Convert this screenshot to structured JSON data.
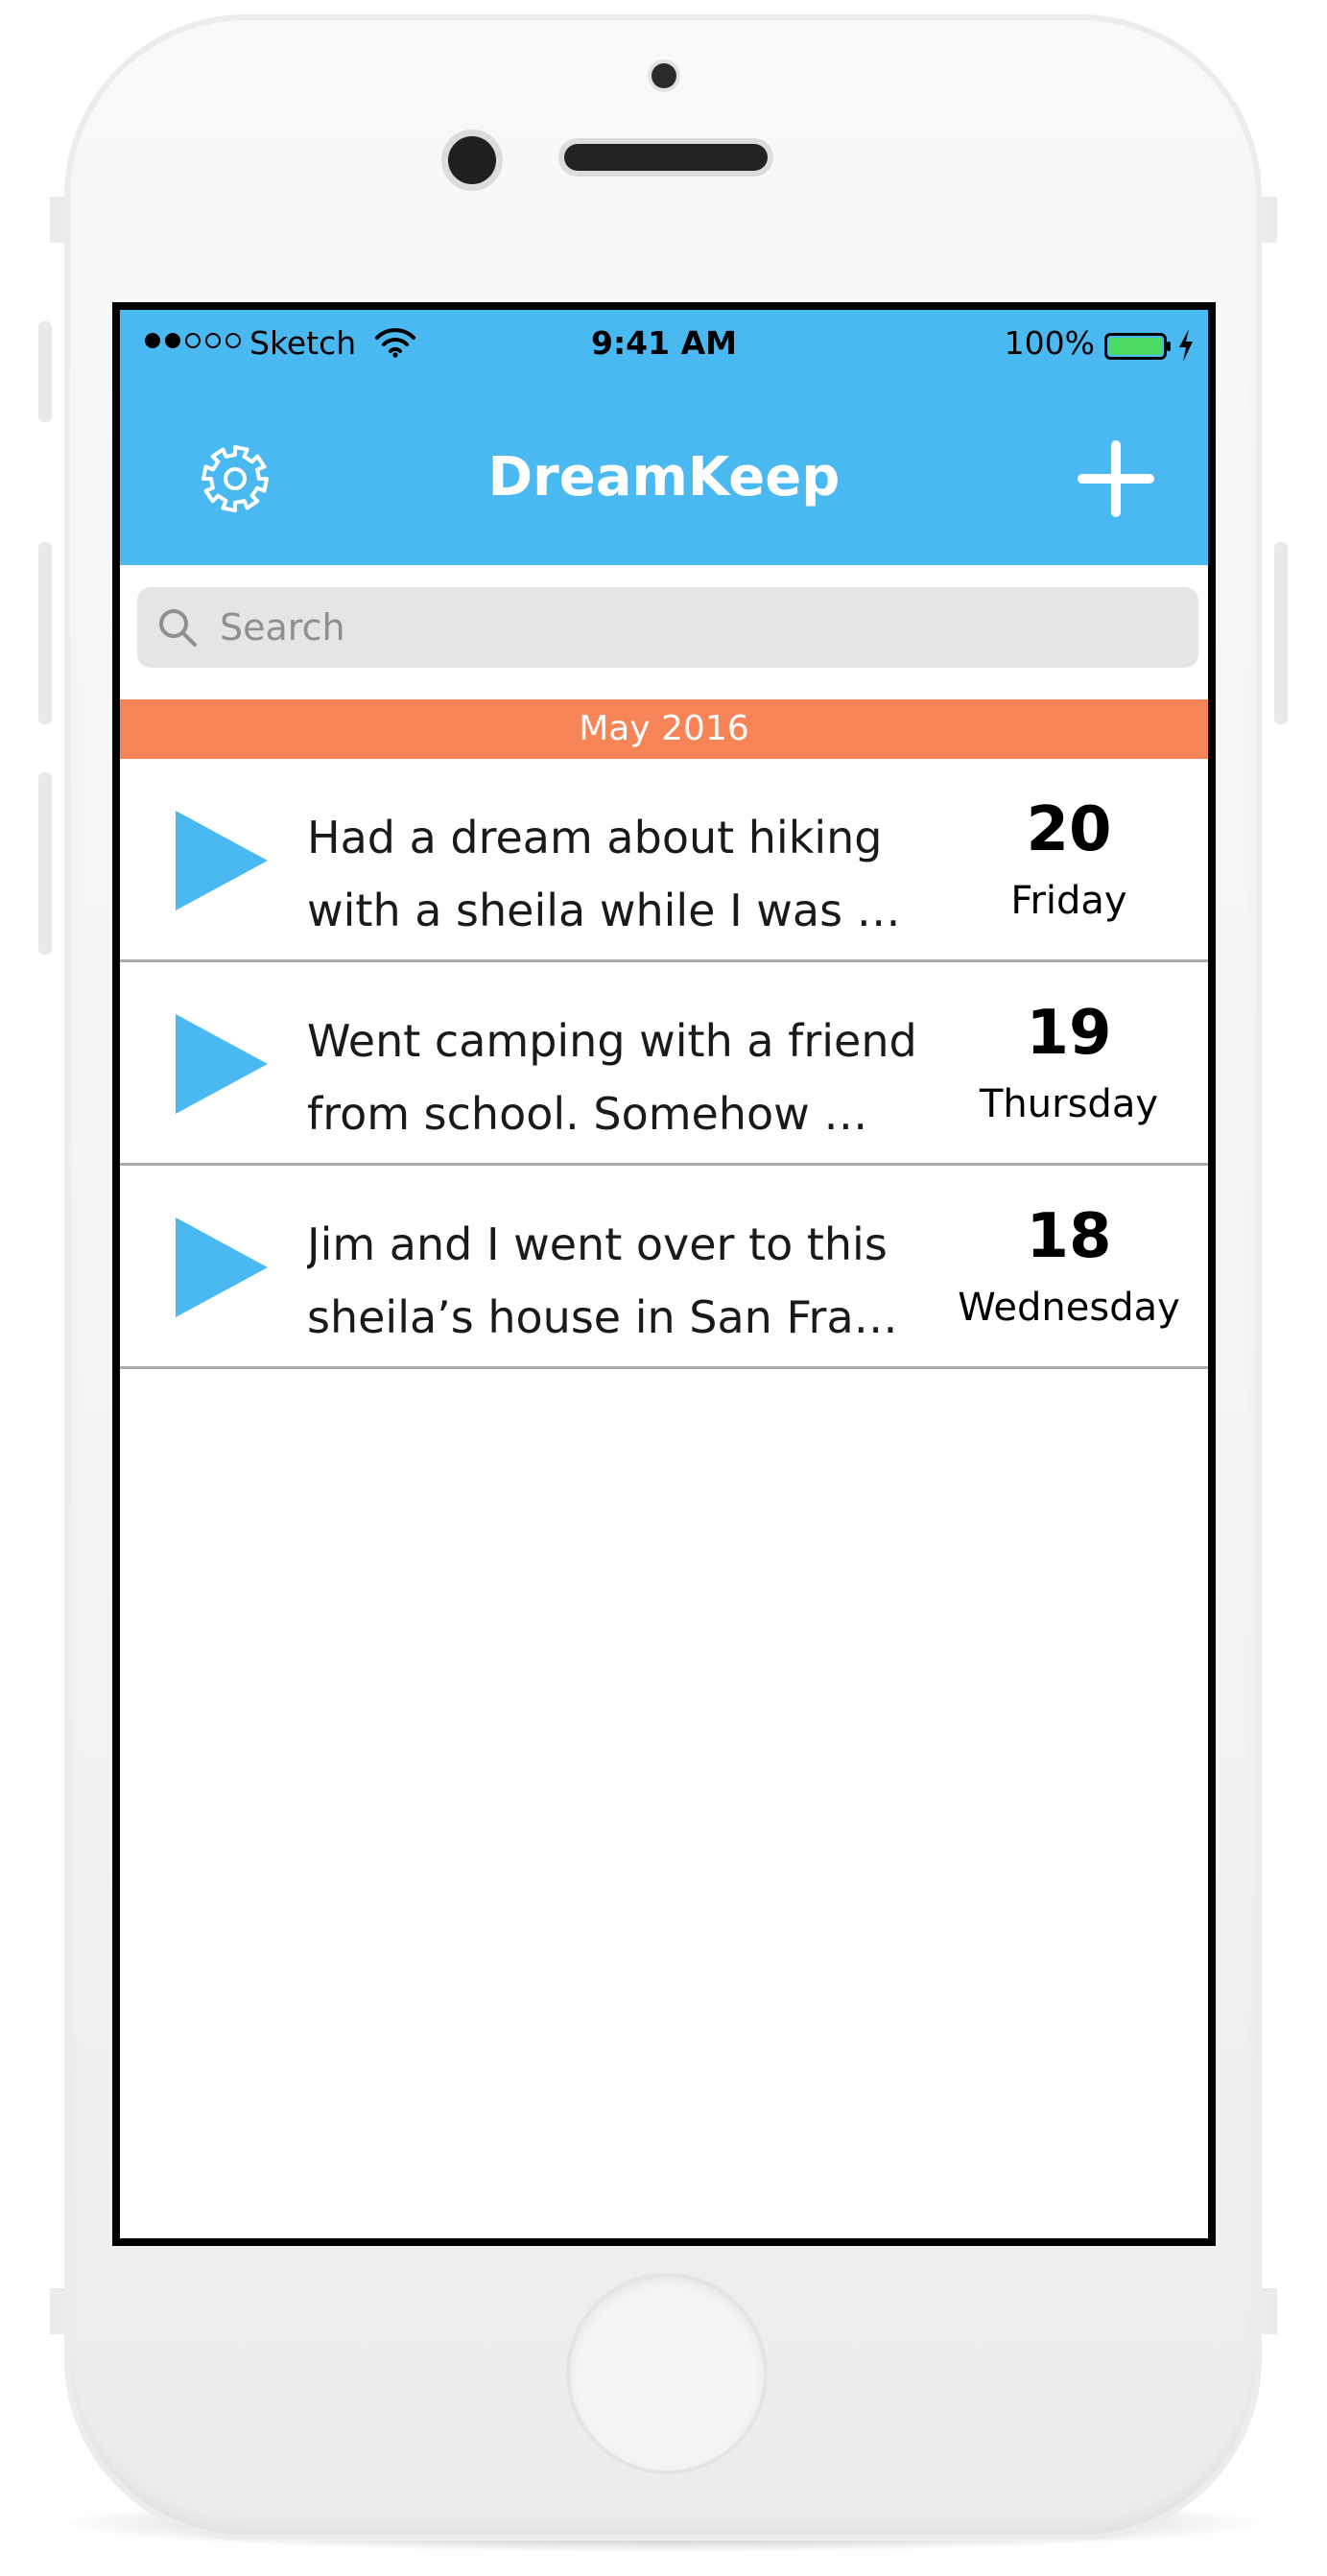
{
  "status_bar": {
    "carrier": "Sketch",
    "time": "9:41 AM",
    "battery_percent": "100%",
    "signal_bars_filled": 2,
    "signal_bars_total": 5
  },
  "nav": {
    "title": "DreamKeep",
    "settings_icon": "gear-icon",
    "add_icon": "plus-icon"
  },
  "search": {
    "placeholder": "Search",
    "value": ""
  },
  "section": {
    "label": "May 2016"
  },
  "entries": [
    {
      "line1": "Had a dream about hiking",
      "line2": "with a sheila while I was …",
      "day": "20",
      "weekday": "Friday"
    },
    {
      "line1": "Went camping with a friend",
      "line2": "from school. Somehow …",
      "day": "19",
      "weekday": "Thursday"
    },
    {
      "line1": "Jim and  I went over to this",
      "line2": "sheila’s house in San Fra…",
      "day": "18",
      "weekday": "Wednesday"
    }
  ],
  "colors": {
    "nav_blue": "#4bb9f1",
    "section_orange": "#f68457",
    "play_blue": "#4bb9f1",
    "battery_green": "#4cd964"
  }
}
